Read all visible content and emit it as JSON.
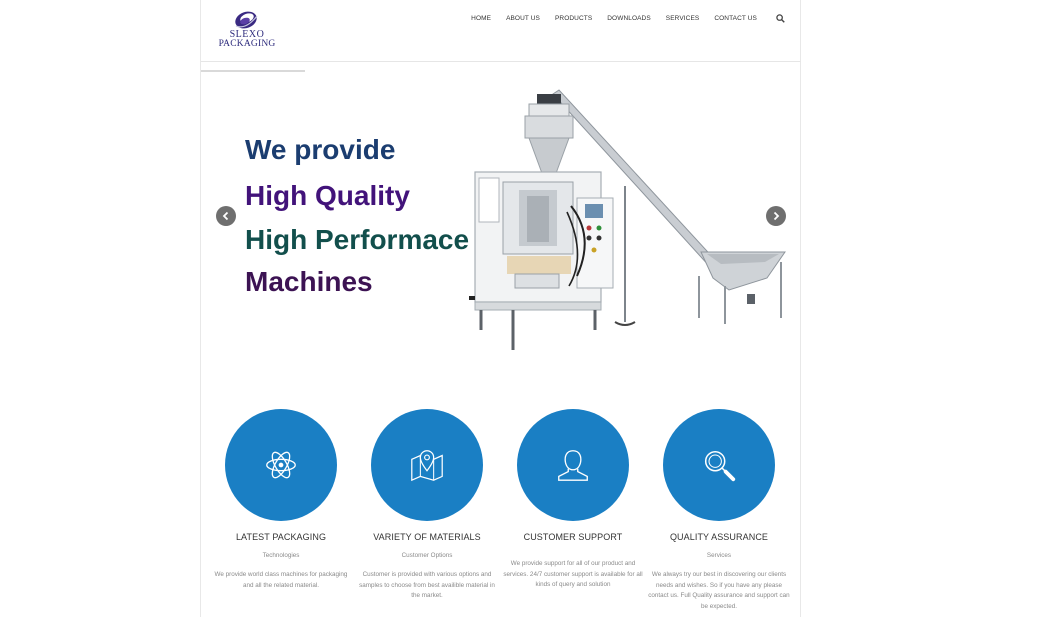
{
  "header": {
    "logo": {
      "line1": "SLEXO",
      "line2": "PACKAGING"
    },
    "nav": [
      "HOME",
      "ABOUT US",
      "PRODUCTS",
      "DOWNLOADS",
      "SERVICES",
      "CONTACT US"
    ],
    "search_icon": "search-icon"
  },
  "slider": {
    "line1": "We provide",
    "line2": "High Quality",
    "line3": "High Performace",
    "line4": "Machines",
    "prev_icon": "chevron-left-icon",
    "next_icon": "chevron-right-icon",
    "image": "packaging-machine-image"
  },
  "features": [
    {
      "icon": "atom-icon",
      "title": "LATEST PACKAGING",
      "subtitle": "Technologies",
      "description": "We provide world class machines for packaging and all the related material."
    },
    {
      "icon": "map-pin-icon",
      "title": "VARIETY OF MATERIALS",
      "subtitle": "Customer Options",
      "description": "Customer is provided with various options and samples to choose from best availible material in the market."
    },
    {
      "icon": "user-icon",
      "title": "CUSTOMER SUPPORT",
      "subtitle": "",
      "description": "We provide support for all of our product and services. 24/7 customer support is available for all kinds of query and solution"
    },
    {
      "icon": "magnifier-icon",
      "title": "QUALITY ASSURANCE",
      "subtitle": "Services",
      "description": "We always try our best in discovering our clients needs and wishes. So if you have any please contact us. Full Quality assurance and support can be expected."
    }
  ],
  "colors": {
    "circle": "#1a7fc4",
    "line1": "#1b3d70",
    "line2": "#42137a",
    "line3": "#124f4c",
    "line4": "#3c1353"
  }
}
